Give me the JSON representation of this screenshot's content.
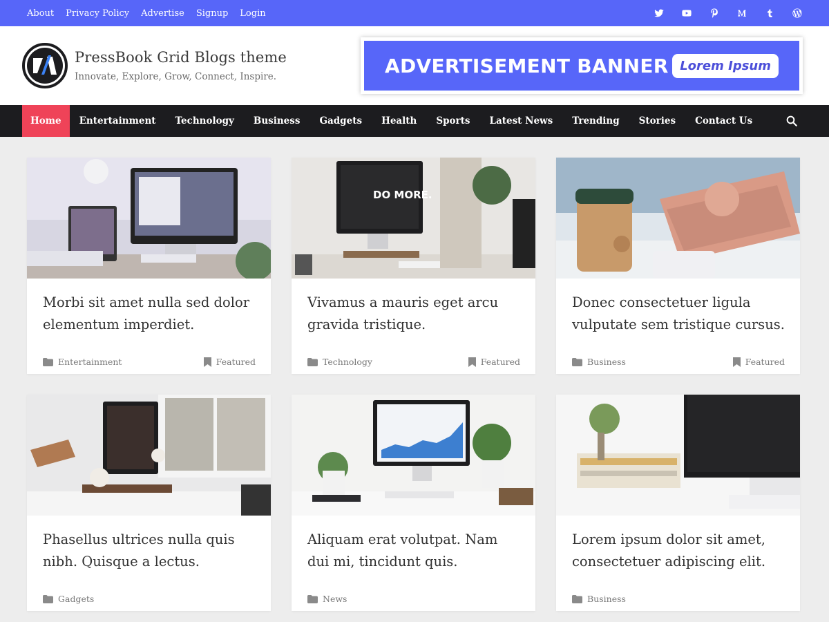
{
  "topbar": {
    "links": [
      "About",
      "Privacy Policy",
      "Advertise",
      "Signup",
      "Login"
    ],
    "social_icons": [
      "twitter-icon",
      "youtube-icon",
      "pinterest-icon",
      "medium-icon",
      "tumblr-icon",
      "wordpress-icon"
    ],
    "bg_color": "#5766f9"
  },
  "header": {
    "site_title": "PressBook Grid Blogs theme",
    "tagline": "Innovate, Explore, Grow, Connect, Inspire.",
    "ad_text": "ADVERTISEMENT BANNER",
    "ad_button": "Lorem Ipsum"
  },
  "nav": {
    "items": [
      "Home",
      "Entertainment",
      "Technology",
      "Business",
      "Gadgets",
      "Health",
      "Sports",
      "Latest News",
      "Trending",
      "Stories",
      "Contact Us"
    ],
    "active": "Home",
    "active_color": "#ef4358"
  },
  "posts": [
    {
      "title": "Morbi sit amet nulla sed dolor elementum imperdiet.",
      "category": "Entertainment",
      "tag": "Featured"
    },
    {
      "title": "Vivamus a mauris eget arcu gravida tristique.",
      "category": "Technology",
      "tag": "Featured"
    },
    {
      "title": "Donec consectetuer ligula vulputate sem tristique cursus.",
      "category": "Business",
      "tag": "Featured"
    },
    {
      "title": "Phasellus ultrices nulla quis nibh. Quisque a lectus.",
      "category": "Gadgets",
      "tag": ""
    },
    {
      "title": "Aliquam erat volutpat. Nam dui mi, tincidunt quis.",
      "category": "News",
      "tag": ""
    },
    {
      "title": "Lorem ipsum dolor sit amet, consectetuer adipiscing elit.",
      "category": "Business",
      "tag": ""
    }
  ],
  "thumb_overlay_text": "DO MORE."
}
